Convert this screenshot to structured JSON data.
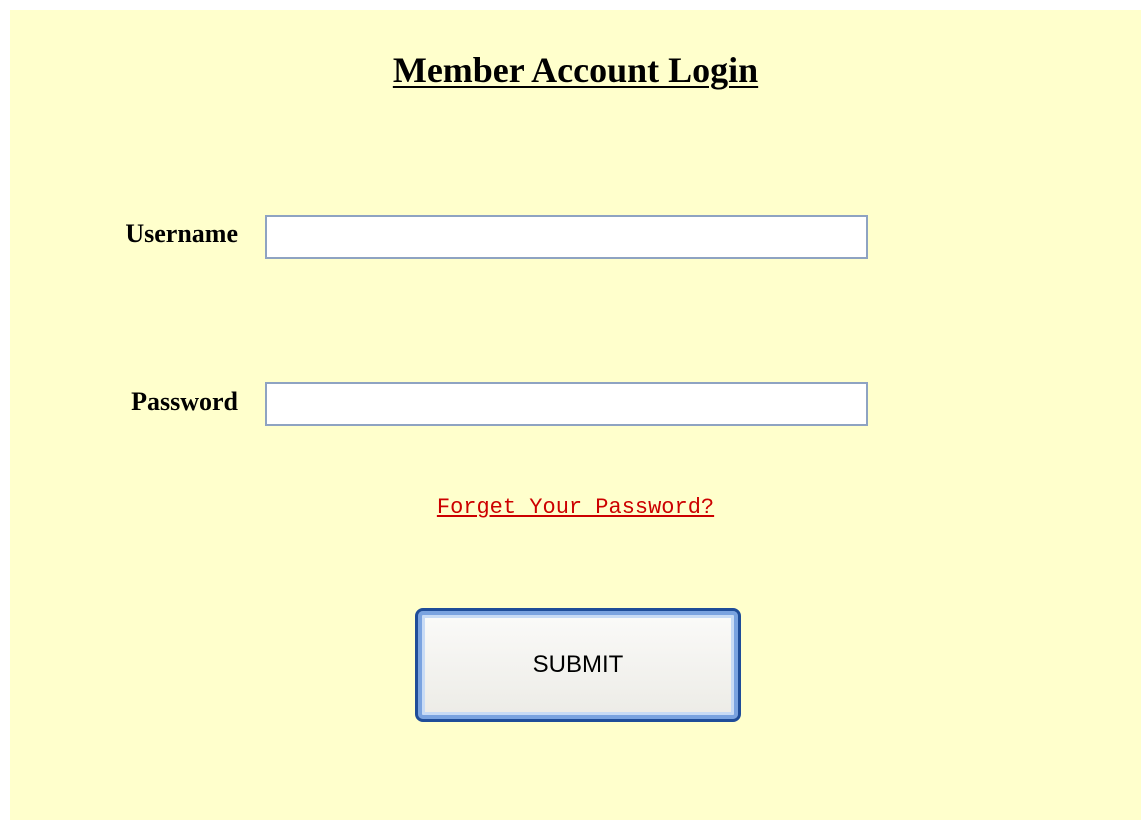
{
  "login": {
    "title": "Member Account Login",
    "username_label": "Username",
    "username_value": "",
    "password_label": "Password",
    "password_value": "",
    "forgot_link": "Forget Your Password?",
    "submit_label": "SUBMIT"
  },
  "colors": {
    "background": "#ffffcc",
    "link": "#cc0000",
    "input_border": "#8ea3c2",
    "button_border": "#1f4d99"
  }
}
